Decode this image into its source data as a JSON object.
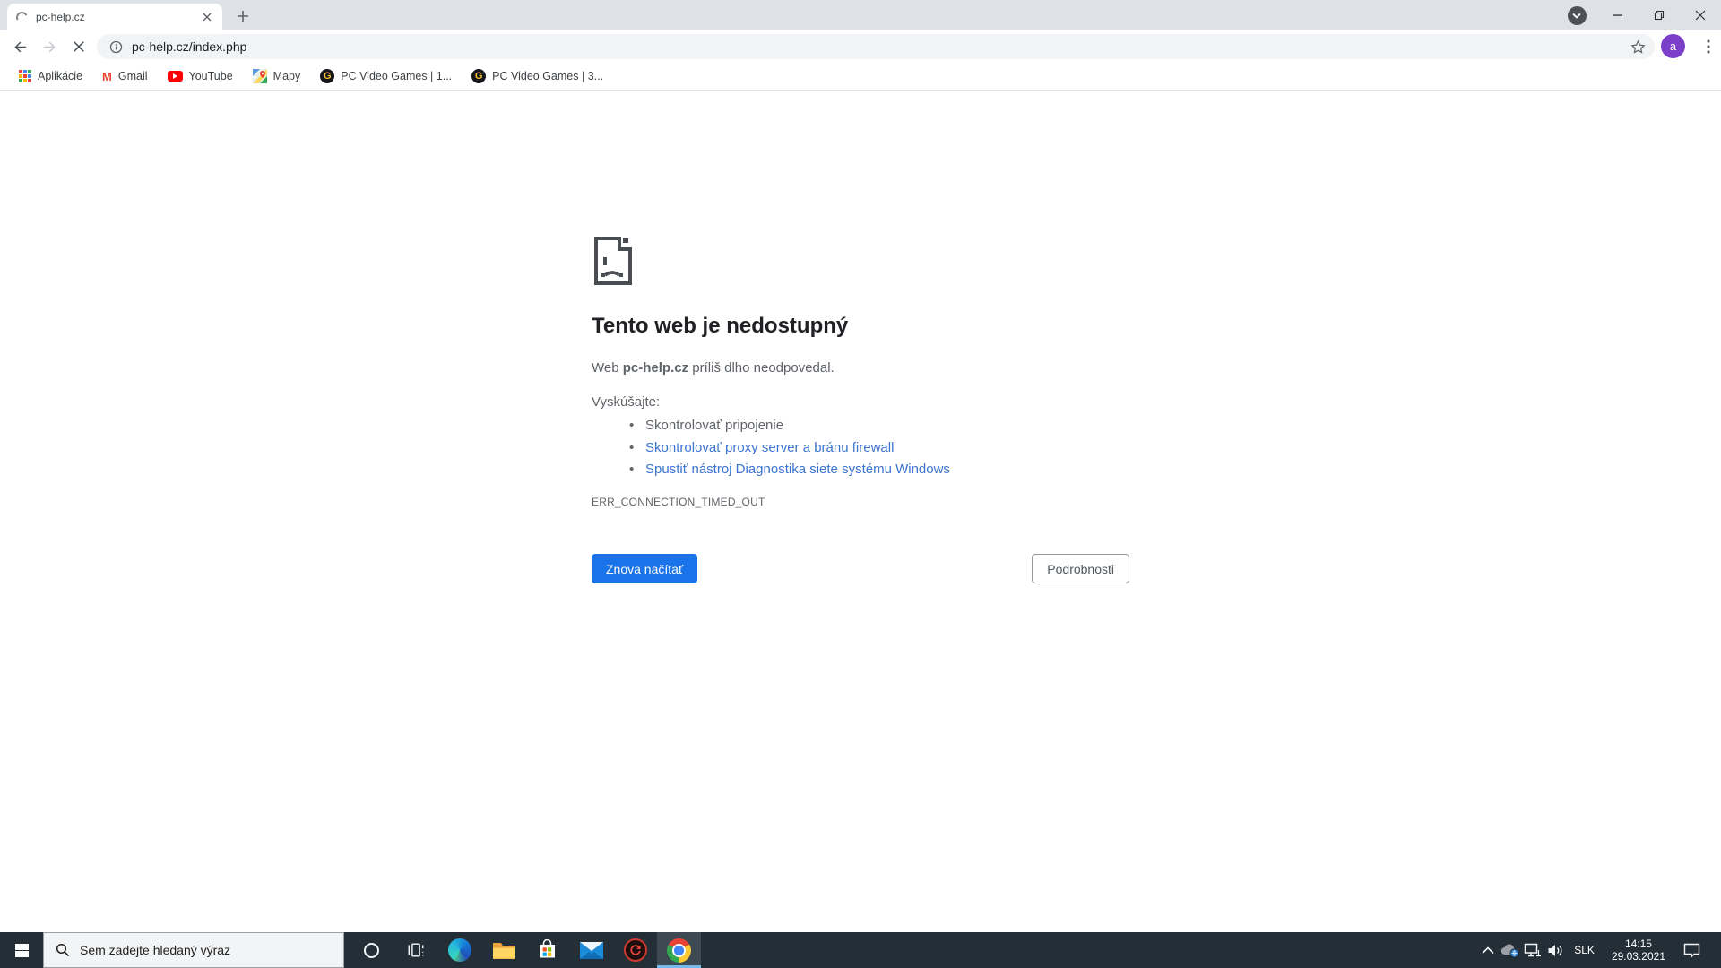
{
  "browser": {
    "tab": {
      "title": "pc-help.cz"
    },
    "urlbar": {
      "url": "pc-help.cz/index.php"
    },
    "profile": {
      "avatar_letter": "a"
    },
    "bookmarks": [
      {
        "label": "Aplikácie"
      },
      {
        "label": "Gmail"
      },
      {
        "label": "YouTube"
      },
      {
        "label": "Mapy"
      },
      {
        "label": "PC Video Games | 1..."
      },
      {
        "label": "PC Video Games | 3..."
      }
    ]
  },
  "error_page": {
    "title": "Tento web je nedostupný",
    "message": {
      "prefix": "Web ",
      "domain": "pc-help.cz",
      "suffix": " príliš dlho neodpovedal."
    },
    "suggestions_heading": "Vyskúšajte:",
    "suggestions": [
      {
        "text": "Skontrolovať pripojenie"
      },
      {
        "text": "Skontrolovať proxy server a bránu firewall"
      },
      {
        "text": "Spustiť nástroj Diagnostika siete systému Windows"
      }
    ],
    "error_code": "ERR_CONNECTION_TIMED_OUT",
    "buttons": {
      "reload": "Znova načítať",
      "details": "Podrobnosti"
    }
  },
  "taskbar": {
    "search": {
      "placeholder": "Sem zadejte hledaný výraz"
    },
    "tray": {
      "language": "SLK",
      "time": "14:15",
      "date": "29.03.2021"
    }
  },
  "colors": {
    "accent_blue": "#1a73e8",
    "link_blue": "#3b74d1",
    "chrome_frame": "#dee1e6",
    "taskbar_bg": "#232e37"
  }
}
